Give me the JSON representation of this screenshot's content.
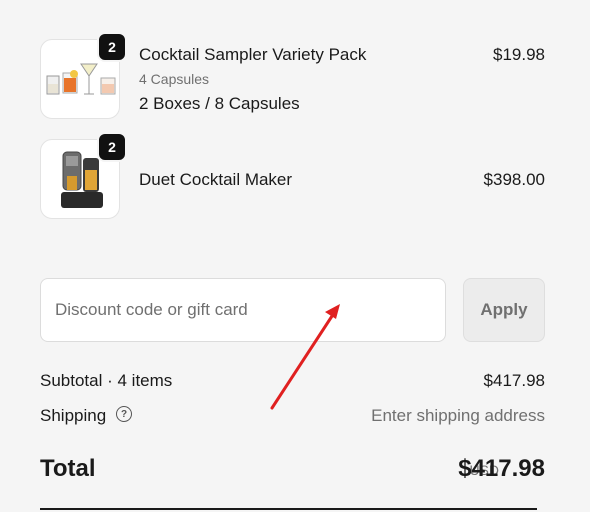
{
  "items": [
    {
      "name": "Cocktail Sampler Variety Pack",
      "subtitle": "4 Capsules",
      "variant": "2 Boxes / 8 Capsules",
      "price": "$19.98",
      "quantity": "2",
      "image_icon": "cocktail-glasses-icon"
    },
    {
      "name": "Duet Cocktail Maker",
      "price": "$398.00",
      "quantity": "2",
      "image_icon": "cocktail-machine-icon"
    }
  ],
  "discount": {
    "placeholder": "Discount code or gift card",
    "apply_label": "Apply"
  },
  "summary": {
    "subtotal_label": "Subtotal · 4 items",
    "subtotal_value": "$417.98",
    "shipping_label": "Shipping",
    "shipping_value": "Enter shipping address",
    "help_symbol": "?",
    "total_label": "Total",
    "currency": "USD",
    "total_value": "$417.98"
  },
  "annotation": {
    "color": "#e02020",
    "icon": "red-arrow-annotation"
  }
}
